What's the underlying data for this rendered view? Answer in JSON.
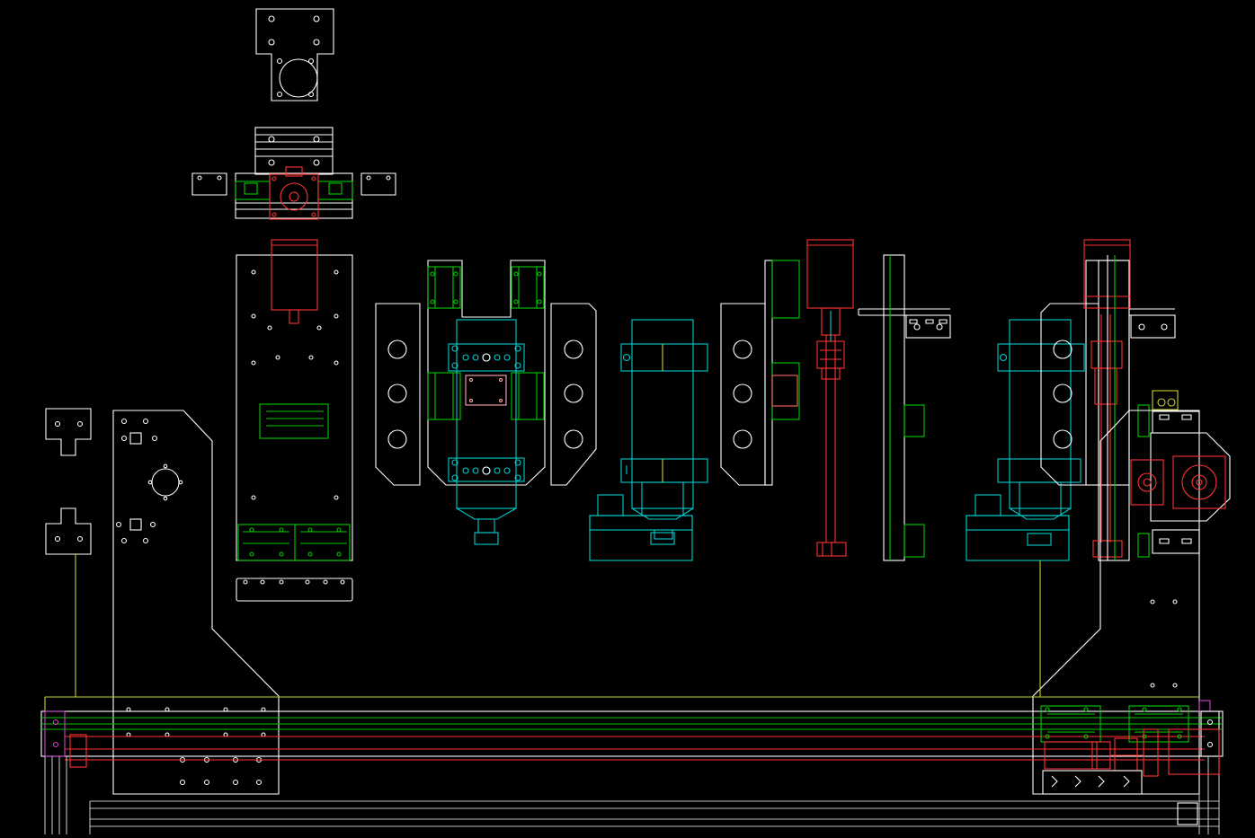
{
  "drawing": {
    "background": "#000000",
    "colors": {
      "outline": "#ffffff",
      "rail": "#00cc00",
      "motor": "#ff0000",
      "carriage": "#00cccc",
      "guide": "#cccc33",
      "accent": "#cc44cc",
      "pad": "#ffaaaa"
    }
  }
}
